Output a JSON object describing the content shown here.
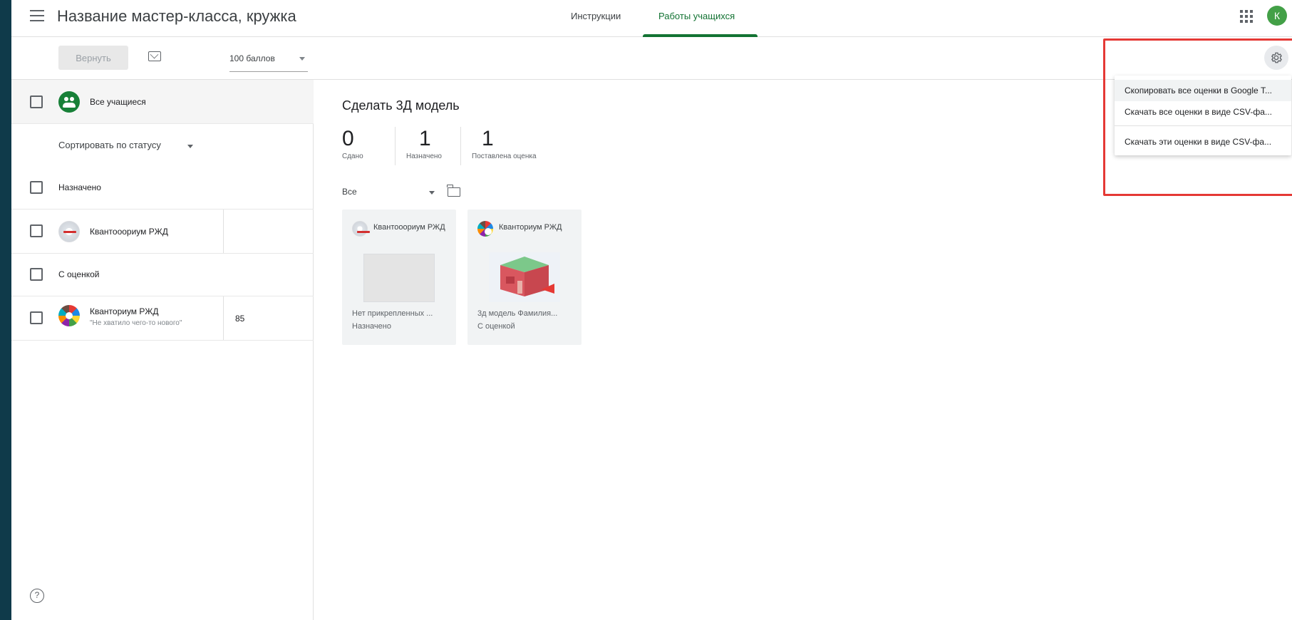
{
  "header": {
    "course_title": "Название мастер-класса, кружка",
    "tabs": [
      {
        "label": "Инструкции"
      },
      {
        "label": "Работы учащихся"
      }
    ],
    "avatar_letter": "К"
  },
  "toolbar": {
    "return_label": "Вернуть",
    "points_value": "100 баллов"
  },
  "settings_menu": {
    "items": [
      {
        "label": "Скопировать все оценки в Google Т..."
      },
      {
        "label": "Скачать все оценки в виде CSV-фа..."
      },
      {
        "label": "Скачать эти оценки в виде CSV-фа..."
      }
    ]
  },
  "left": {
    "all_students": "Все учащиеся",
    "sort_label": "Сортировать по статусу",
    "group_assigned": "Назначено",
    "group_graded": "С оценкой",
    "students": [
      {
        "name": "Квантооориум РЖД",
        "comment": "",
        "grade": ""
      },
      {
        "name": "Кванториум РЖД",
        "comment": "\"Не хватило чего-то нового\"",
        "grade": "85"
      }
    ]
  },
  "main": {
    "assignment_title": "Сделать 3Д модель",
    "stats": [
      {
        "value": "0",
        "caption": "Сдано"
      },
      {
        "value": "1",
        "caption": "Назначено"
      },
      {
        "value": "1",
        "caption": "Поставлена оценка"
      }
    ],
    "filter_value": "Все",
    "cards": [
      {
        "name": "Квантооориум РЖД",
        "file": "Нет прикрепленных ...",
        "status": "Назначено"
      },
      {
        "name": "Кванториум РЖД",
        "file": "3д модель Фамилия...",
        "status": "С оценкой"
      }
    ]
  }
}
